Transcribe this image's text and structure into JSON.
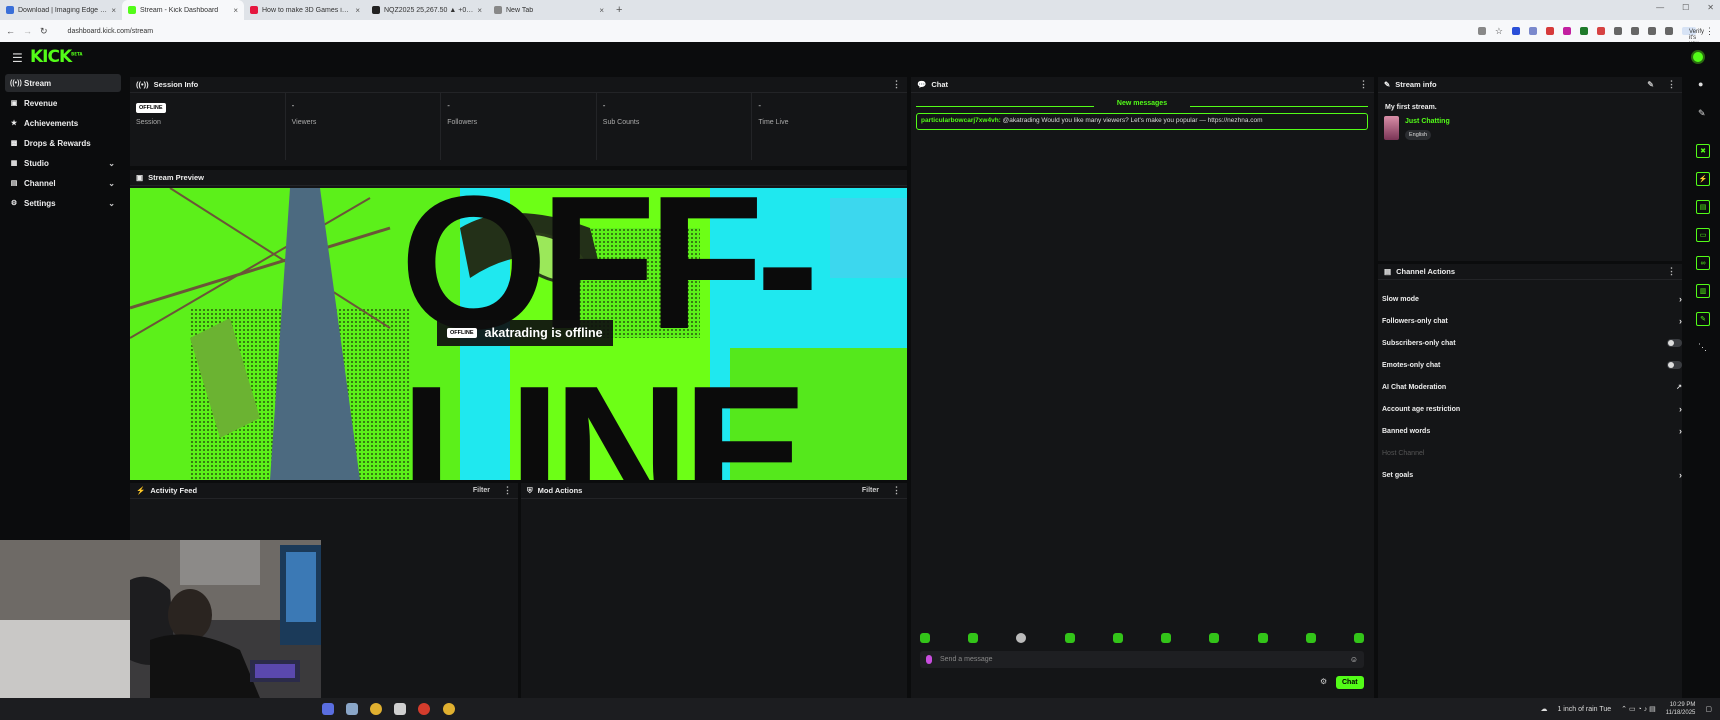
{
  "browser": {
    "tabs": [
      {
        "title": "Download | Imaging Edge Web...",
        "favicon_color": "#3a6fd8",
        "active": false
      },
      {
        "title": "Stream - Kick Dashboard",
        "favicon_color": "#53fc18",
        "active": true
      },
      {
        "title": "How to make 3D Games in Go...",
        "favicon_color": "#e5173f",
        "active": false
      },
      {
        "title": "NQZ2025 25,267.50 ▲ +0.48% ...",
        "favicon_color": "#222222",
        "active": false
      },
      {
        "title": "New Tab",
        "favicon_color": "#888888",
        "active": false
      }
    ],
    "url": "dashboard.kick.com/stream",
    "verify_label": "Verify it's you"
  },
  "sidebar": {
    "items": [
      {
        "label": "Stream",
        "icon": "broadcast-icon",
        "active": true,
        "expandable": false
      },
      {
        "label": "Revenue",
        "icon": "revenue-icon",
        "active": false,
        "expandable": false
      },
      {
        "label": "Achievements",
        "icon": "trophy-icon",
        "active": false,
        "expandable": false
      },
      {
        "label": "Drops & Rewards",
        "icon": "gift-icon",
        "active": false,
        "expandable": false
      },
      {
        "label": "Studio",
        "icon": "studio-icon",
        "active": false,
        "expandable": true
      },
      {
        "label": "Channel",
        "icon": "channel-icon",
        "active": false,
        "expandable": true
      },
      {
        "label": "Settings",
        "icon": "gear-icon",
        "active": false,
        "expandable": true
      }
    ]
  },
  "session_info": {
    "title": "Session Info",
    "badge": "OFFLINE",
    "stats": [
      {
        "label": "Session",
        "value": ""
      },
      {
        "label": "Viewers",
        "value": "-"
      },
      {
        "label": "Followers",
        "value": "-"
      },
      {
        "label": "Sub Counts",
        "value": "-"
      },
      {
        "label": "Time Live",
        "value": "-"
      }
    ]
  },
  "stream_preview": {
    "title": "Stream Preview",
    "badge": "OFFLINE",
    "status_text": "akatrading is offline"
  },
  "activity_feed": {
    "title": "Activity Feed",
    "filter_label": "Filter"
  },
  "mod_actions": {
    "title": "Mod Actions",
    "filter_label": "Filter"
  },
  "chat": {
    "title": "Chat",
    "new_messages_label": "New messages",
    "messages": [
      {
        "user": "particularbowcarj7xw4vh:",
        "text": " @akatrading Would you like many viewers? Let's make you popular — https://nezhna.com"
      }
    ],
    "input_placeholder": "Send a message",
    "send_label": "Chat"
  },
  "stream_info": {
    "title": "Stream info",
    "stream_title": "My first stream.",
    "category": "Just Chatting",
    "language": "English"
  },
  "channel_actions": {
    "title": "Channel Actions",
    "items": [
      {
        "label": "Slow mode",
        "control": "arrow"
      },
      {
        "label": "Followers-only chat",
        "control": "arrow"
      },
      {
        "label": "Subscribers-only chat",
        "control": "toggle",
        "enabled": false
      },
      {
        "label": "Emotes-only chat",
        "control": "toggle",
        "enabled": false
      },
      {
        "label": "AI Chat Moderation",
        "control": "external"
      },
      {
        "label": "Account age restriction",
        "control": "arrow"
      },
      {
        "label": "Banned words",
        "control": "arrow"
      },
      {
        "label": "Host Channel",
        "control": "none",
        "disabled": true
      },
      {
        "label": "Set goals",
        "control": "arrow"
      }
    ]
  },
  "taskbar": {
    "weather": "1 inch of rain Tue",
    "time": "10:29 PM",
    "date": "11/18/2025"
  },
  "colors": {
    "accent": "#53fc18",
    "panel": "#141517",
    "background": "#0b0c0d"
  }
}
